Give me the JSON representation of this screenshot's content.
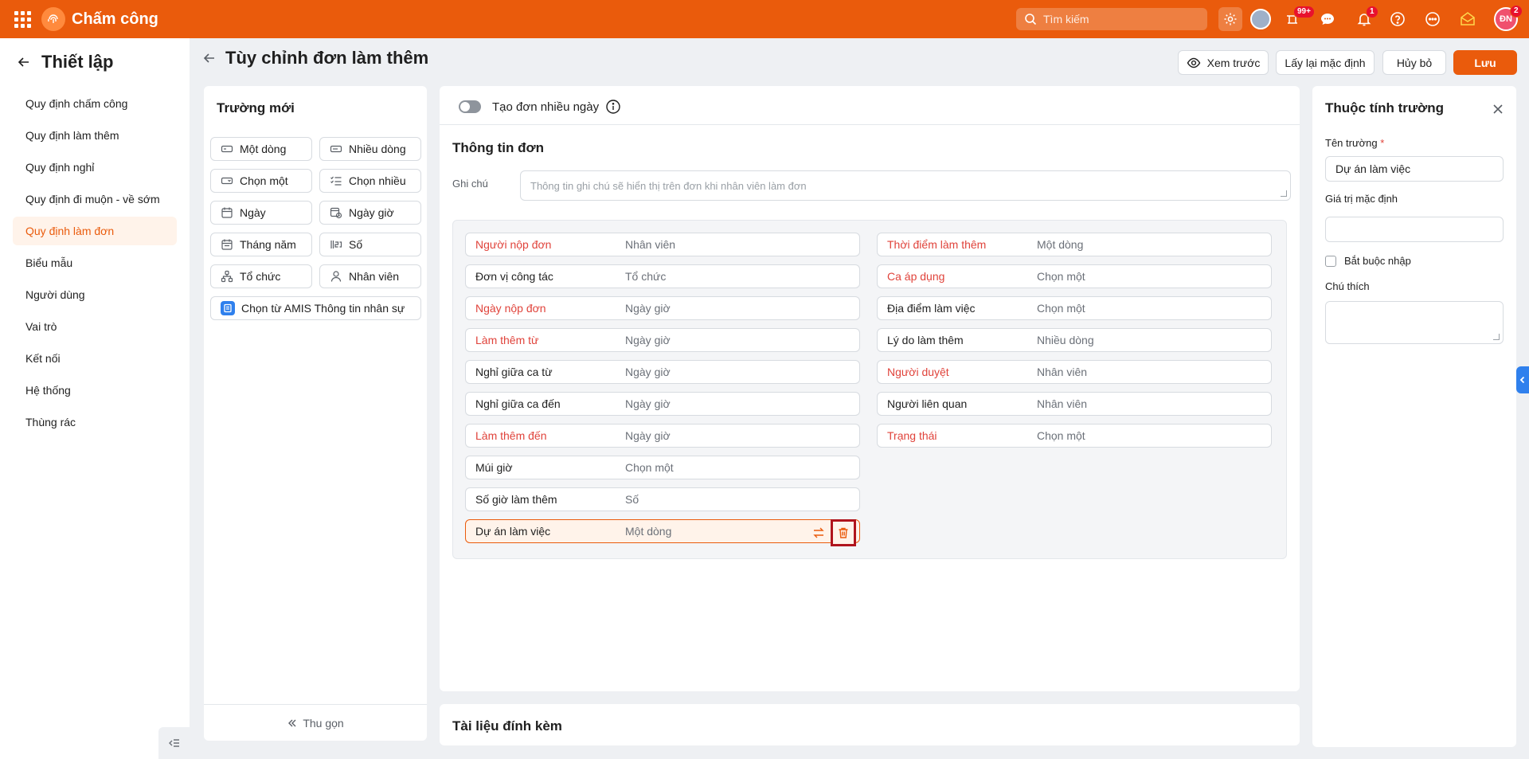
{
  "app": {
    "title": "Chấm công"
  },
  "topbar": {
    "search_placeholder": "Tìm kiếm",
    "tools_badge": "99+",
    "notification_badge": "1",
    "user_initials": "ĐN",
    "user_badge": "2"
  },
  "sidebar": {
    "title": "Thiết lập",
    "items": [
      {
        "label": "Quy định chấm công"
      },
      {
        "label": "Quy định làm thêm"
      },
      {
        "label": "Quy định nghỉ"
      },
      {
        "label": "Quy định đi muộn - về sớm"
      },
      {
        "label": "Quy định làm đơn"
      },
      {
        "label": "Biểu mẫu"
      },
      {
        "label": "Người dùng"
      },
      {
        "label": "Vai trò"
      },
      {
        "label": "Kết nối"
      },
      {
        "label": "Hệ thống"
      },
      {
        "label": "Thùng rác"
      }
    ],
    "active_index": 4
  },
  "header": {
    "title": "Tùy chỉnh đơn làm thêm",
    "preview_label": "Xem trước",
    "reset_label": "Lấy lại mặc định",
    "cancel_label": "Hủy bỏ",
    "save_label": "Lưu"
  },
  "new_fields": {
    "title": "Trường mới",
    "items": [
      {
        "label": "Một dòng",
        "icon": "single-line-icon"
      },
      {
        "label": "Nhiều dòng",
        "icon": "multi-line-icon"
      },
      {
        "label": "Chọn một",
        "icon": "select-one-icon"
      },
      {
        "label": "Chọn nhiều",
        "icon": "select-many-icon"
      },
      {
        "label": "Ngày",
        "icon": "calendar-icon"
      },
      {
        "label": "Ngày giờ",
        "icon": "datetime-icon"
      },
      {
        "label": "Tháng năm",
        "icon": "month-year-icon"
      },
      {
        "label": "Số",
        "icon": "number-icon"
      },
      {
        "label": "Tổ chức",
        "icon": "organization-icon"
      },
      {
        "label": "Nhân viên",
        "icon": "employee-icon"
      },
      {
        "label": "Chọn từ AMIS Thông tin nhân sự",
        "icon": "amis-icon"
      }
    ],
    "collapse_label": "Thu gọn"
  },
  "form": {
    "multi_day_label": "Tạo đơn nhiều ngày",
    "section_title": "Thông tin đơn",
    "note_label": "Ghi chú",
    "note_placeholder": "Thông tin ghi chú sẽ hiển thị trên đơn khi nhân viên làm đơn",
    "left_fields": [
      {
        "name": "Người nộp đơn",
        "type": "Nhân viên",
        "required": true
      },
      {
        "name": "Đơn vị công tác",
        "type": "Tổ chức",
        "required": false
      },
      {
        "name": "Ngày nộp đơn",
        "type": "Ngày giờ",
        "required": true
      },
      {
        "name": "Làm thêm từ",
        "type": "Ngày giờ",
        "required": true
      },
      {
        "name": "Nghỉ giữa ca từ",
        "type": "Ngày giờ",
        "required": false
      },
      {
        "name": "Nghỉ giữa ca đến",
        "type": "Ngày giờ",
        "required": false
      },
      {
        "name": "Làm thêm đến",
        "type": "Ngày giờ",
        "required": true
      },
      {
        "name": "Múi giờ",
        "type": "Chọn một",
        "required": false
      },
      {
        "name": "Số giờ làm thêm",
        "type": "Số",
        "required": false
      },
      {
        "name": "Dự án làm việc",
        "type": "Một dòng",
        "required": false,
        "selected": true
      }
    ],
    "right_fields": [
      {
        "name": "Thời điểm làm thêm",
        "type": "Một dòng",
        "required": true
      },
      {
        "name": "Ca áp dụng",
        "type": "Chọn một",
        "required": true
      },
      {
        "name": "Địa điểm làm việc",
        "type": "Chọn một",
        "required": false
      },
      {
        "name": "Lý do làm thêm",
        "type": "Nhiều dòng",
        "required": false
      },
      {
        "name": "Người duyệt",
        "type": "Nhân viên",
        "required": true
      },
      {
        "name": "Người liên quan",
        "type": "Nhân viên",
        "required": false
      },
      {
        "name": "Trạng thái",
        "type": "Chọn một",
        "required": true
      }
    ],
    "attachments_title": "Tài liệu đính kèm"
  },
  "properties": {
    "title": "Thuộc tính trường",
    "name_label": "Tên trường",
    "required_mark": "*",
    "name_value": "Dự án làm việc",
    "default_label": "Giá trị mặc định",
    "default_value": "",
    "mandatory_label": "Bắt buộc nhập",
    "note_label": "Chú thích"
  },
  "colors": {
    "brand": "#ea5b0c",
    "required": "#e0433b",
    "accent_blue": "#2f80ed"
  }
}
